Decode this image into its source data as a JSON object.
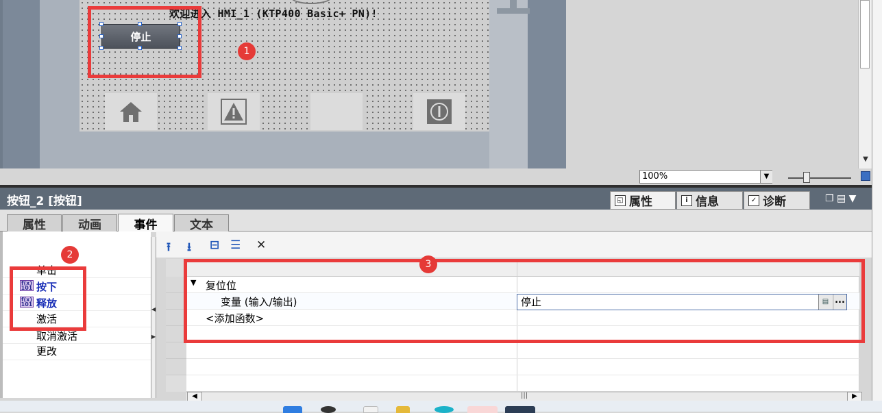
{
  "hmi_screen": {
    "welcome_text": "欢迎进入 HMI_1 (KTP400 Basic+ PN)!",
    "stop_button_label": "停止",
    "nav_buttons": [
      {
        "icon": "home-icon"
      },
      {
        "icon": "alarm-warning-icon"
      },
      {
        "icon": "blank"
      },
      {
        "icon": "power-info-icon"
      }
    ]
  },
  "zoom": {
    "value": "100%"
  },
  "inspector": {
    "title": "按钮_2 [按钮]",
    "tabs": [
      {
        "label": "属性",
        "icon": "properties-icon",
        "active": true
      },
      {
        "label": "信息",
        "icon": "info-icon",
        "active": false
      },
      {
        "label": "诊断",
        "icon": "diagnostics-icon",
        "active": false
      }
    ]
  },
  "property_tabs": [
    {
      "label": "属性",
      "active": false
    },
    {
      "label": "动画",
      "active": false
    },
    {
      "label": "事件",
      "active": true
    },
    {
      "label": "文本",
      "active": false
    }
  ],
  "events": [
    {
      "label": "单击",
      "bold": false,
      "has_icon": false
    },
    {
      "label": "按下",
      "bold": true,
      "has_icon": true
    },
    {
      "label": "释放",
      "bold": true,
      "has_icon": true
    },
    {
      "label": "激活",
      "bold": false,
      "has_icon": false
    },
    {
      "label": "取消激活",
      "bold": false,
      "has_icon": false
    },
    {
      "label": "更改",
      "bold": false,
      "has_icon": false
    }
  ],
  "function_list": {
    "function_name": "复位位",
    "param_label": "变量 (输入/输出)",
    "param_value": "停止",
    "add_function": "<添加函数>"
  },
  "annotations": {
    "badge_1": "1",
    "badge_2": "2",
    "badge_3": "3"
  },
  "colors": {
    "annotation_red": "#ea3b3b",
    "inspector_header": "#5e6a77",
    "event_bold_blue": "#1a2fb7"
  }
}
